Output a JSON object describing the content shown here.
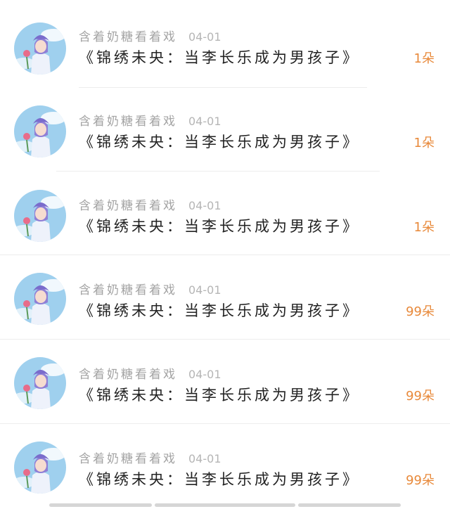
{
  "items": [
    {
      "user": "含着奶糖看着戏",
      "date": "04-01",
      "title": "《锦绣未央：当李长乐成为男孩子》",
      "count": "1朵"
    },
    {
      "user": "含着奶糖看着戏",
      "date": "04-01",
      "title": "《锦绣未央：当李长乐成为男孩子》",
      "count": "1朵"
    },
    {
      "user": "含着奶糖看着戏",
      "date": "04-01",
      "title": "《锦绣未央：当李长乐成为男孩子》",
      "count": "1朵"
    },
    {
      "user": "含着奶糖看着戏",
      "date": "04-01",
      "title": "《锦绣未央：当李长乐成为男孩子》",
      "count": "99朵"
    },
    {
      "user": "含着奶糖看着戏",
      "date": "04-01",
      "title": "《锦绣未央：当李长乐成为男孩子》",
      "count": "99朵"
    },
    {
      "user": "含着奶糖看着戏",
      "date": "04-01",
      "title": "《锦绣未央：当李长乐成为男孩子》",
      "count": "99朵"
    }
  ],
  "colors": {
    "count": "#e8893a",
    "meta": "#a3a3a3",
    "title": "#222222"
  }
}
